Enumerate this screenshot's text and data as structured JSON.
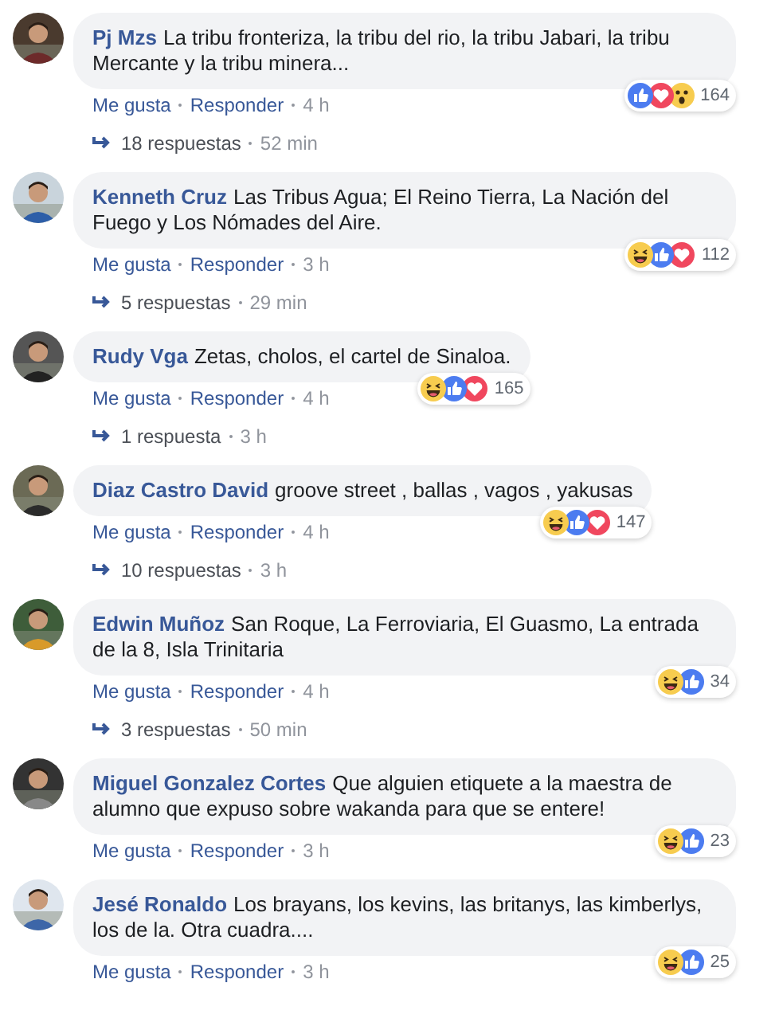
{
  "comments": [
    {
      "author": "Pj Mzs",
      "text": "La tribu fronteriza, la tribu del rio, la tribu Jabari, la tribu Mercante y la tribu minera...",
      "reactions": [
        {
          "kind": "like"
        },
        {
          "kind": "love"
        },
        {
          "kind": "wow"
        }
      ],
      "reaction_count": "164",
      "like": "Me gusta",
      "reply": "Responder",
      "time": "4 h",
      "replies": {
        "count": "18 respuestas",
        "time": "52 min"
      }
    },
    {
      "author": "Kenneth Cruz",
      "text": "Las Tribus Agua; El Reino Tierra, La Nación del Fuego y Los Nómades del Aire.",
      "reactions": [
        {
          "kind": "haha"
        },
        {
          "kind": "like"
        },
        {
          "kind": "love"
        }
      ],
      "reaction_count": "112",
      "like": "Me gusta",
      "reply": "Responder",
      "time": "3 h",
      "replies": {
        "count": "5 respuestas",
        "time": "29 min"
      }
    },
    {
      "author": "Rudy Vga",
      "text": "Zetas, cholos, el cartel de Sinaloa.",
      "reactions": [
        {
          "kind": "haha"
        },
        {
          "kind": "like"
        },
        {
          "kind": "love"
        }
      ],
      "reaction_count": "165",
      "like": "Me gusta",
      "reply": "Responder",
      "time": "4 h",
      "replies": {
        "count": "1 respuesta",
        "time": "3 h"
      }
    },
    {
      "author": "Diaz Castro David",
      "text": "groove street , ballas , vagos , yakusas",
      "reactions": [
        {
          "kind": "haha"
        },
        {
          "kind": "like"
        },
        {
          "kind": "love"
        }
      ],
      "reaction_count": "147",
      "like": "Me gusta",
      "reply": "Responder",
      "time": "4 h",
      "replies": {
        "count": "10 respuestas",
        "time": "3 h"
      }
    },
    {
      "author": "Edwin Muñoz",
      "text": "San Roque, La Ferroviaria, El Guasmo, La entrada de la 8, Isla Trinitaria",
      "reactions": [
        {
          "kind": "haha"
        },
        {
          "kind": "like"
        }
      ],
      "reaction_count": "34",
      "like": "Me gusta",
      "reply": "Responder",
      "time": "4 h",
      "replies": {
        "count": "3 respuestas",
        "time": "50 min"
      }
    },
    {
      "author": "Miguel Gonzalez Cortes",
      "text": "Que alguien etiquete a la maestra de alumno que expuso sobre wakanda para que se entere!",
      "reactions": [
        {
          "kind": "haha"
        },
        {
          "kind": "like"
        }
      ],
      "reaction_count": "23",
      "like": "Me gusta",
      "reply": "Responder",
      "time": "3 h"
    },
    {
      "author": "Jesé Ronaldo",
      "text": "Los brayans, los kevins, las britanys, las kimberlys, los de la. Otra cuadra....",
      "reactions": [
        {
          "kind": "haha"
        },
        {
          "kind": "like"
        }
      ],
      "reaction_count": "25",
      "like": "Me gusta",
      "reply": "Responder",
      "time": "3 h"
    }
  ]
}
